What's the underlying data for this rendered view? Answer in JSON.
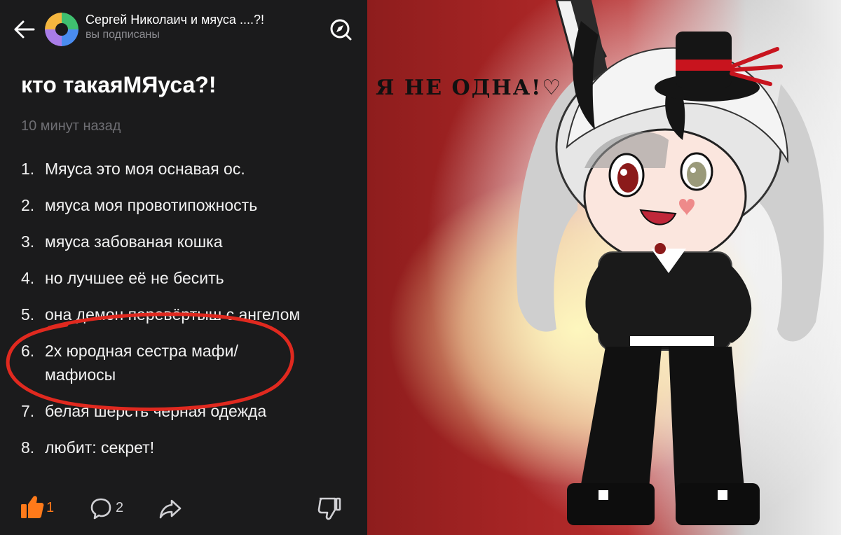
{
  "header": {
    "channel_name": "Сергей Николаич и мяуса ....?!",
    "subscription_status": "вы подписаны",
    "back_icon": "arrow-left-icon",
    "explore_icon": "compass-icon"
  },
  "article": {
    "title": "кто такаяМЯуса?!",
    "timestamp": "10 минут назад",
    "items": [
      {
        "num": "1.",
        "text": "Мяуса это моя оснавая ос."
      },
      {
        "num": "2.",
        "text": "мяуса моя провотипожность"
      },
      {
        "num": "3.",
        "text": "мяуса забованая кошка"
      },
      {
        "num": "4.",
        "text": "но лучшее её не бесить"
      },
      {
        "num": "5.",
        "text": "она демон перевёртыш с ангелом"
      },
      {
        "num": "6.",
        "text": "2х юродная сестра мафи/",
        "text2": "мафиосы"
      },
      {
        "num": "7.",
        "text": "белая шерсть черная одежда"
      },
      {
        "num": "8.",
        "text": "любит: секрет!"
      }
    ]
  },
  "actions": {
    "likes": "1",
    "comments": "2",
    "like_icon": "thumbs-up-icon",
    "comment_icon": "comment-bubble-icon",
    "share_icon": "share-arrow-icon",
    "dislike_icon": "thumbs-down-icon",
    "like_color": "#ff7a1a"
  },
  "illustration": {
    "caption": "Я НЕ ОДНА!♡",
    "colors": {
      "background_red": "#a52424",
      "glow_yellow": "#fff6b8",
      "hat_band": "#c8141e"
    }
  }
}
